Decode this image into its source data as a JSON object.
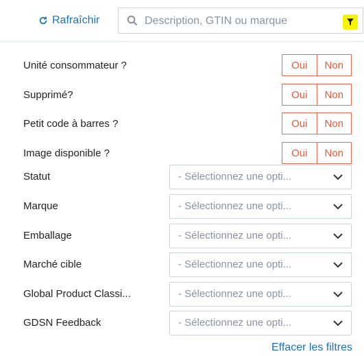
{
  "toolbar": {
    "refresh_label": "Rafraîchir",
    "search_placeholder": "Description, GTIN ou marque",
    "filter_highlight": "#f5f500"
  },
  "toggles": [
    {
      "label": "Unité consommateur ?",
      "yes": "Oui",
      "no": "Non"
    },
    {
      "label": "Supprimé?",
      "yes": "Oui",
      "no": "Non"
    },
    {
      "label": "Petit code à barres ?",
      "yes": "Oui",
      "no": "Non"
    },
    {
      "label": "Image disponible ?",
      "yes": "Oui",
      "no": "Non"
    }
  ],
  "selects": [
    {
      "label": "Statut",
      "placeholder": "- Sélectionnez une opti..."
    },
    {
      "label": "Marque",
      "placeholder": "- Sélectionnez une opti..."
    },
    {
      "label": "Emballage",
      "placeholder": "- Sélectionnez une opti..."
    },
    {
      "label": "Marché cible",
      "placeholder": "- Sélectionnez une opti..."
    },
    {
      "label": "Global Product Classi...",
      "placeholder": "- Sélectionnez une opti..."
    },
    {
      "label": "GDSN Feedback",
      "placeholder": "- Sélectionnez une opti..."
    }
  ],
  "footer": {
    "clear_label": "Effacer les filtres"
  },
  "colors": {
    "accent": "#1a74b8",
    "toggle_border": "#f0674b",
    "toggle_text": "#e35a3a"
  }
}
